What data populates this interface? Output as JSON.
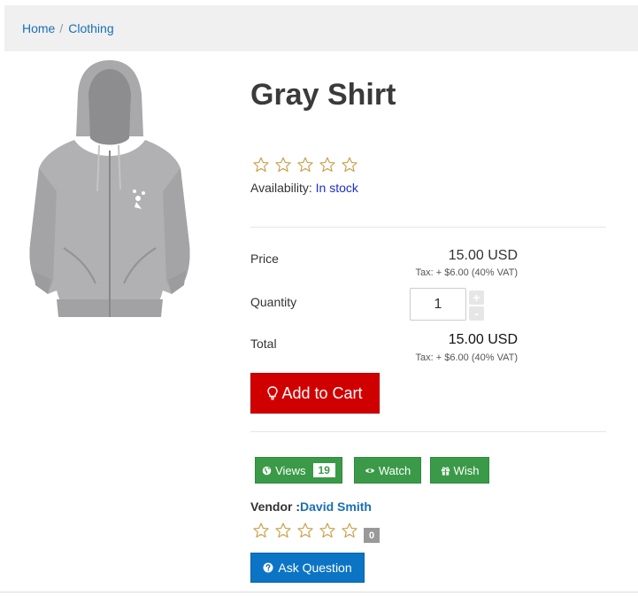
{
  "breadcrumb": {
    "home": "Home",
    "separator": "/",
    "category": "Clothing"
  },
  "product": {
    "title": "Gray Shirt",
    "availability_label": "Availability:",
    "availability_value": "In stock",
    "rating": 0,
    "max_rating": 5
  },
  "pricing": {
    "price_label": "Price",
    "price_value": "15.00 USD",
    "price_tax": "Tax: + $6.00 (40% VAT)",
    "quantity_label": "Quantity",
    "quantity_value": "1",
    "plus": "+",
    "minus": "-",
    "total_label": "Total",
    "total_value": "15.00 USD",
    "total_tax": "Tax: + $6.00 (40% VAT)"
  },
  "actions": {
    "add_to_cart": "Add to Cart",
    "views_label": "Views",
    "views_count": "19",
    "watch_label": "Watch",
    "wish_label": "Wish",
    "ask_question": "Ask Question"
  },
  "vendor": {
    "label": "Vendor :",
    "name": "David Smith",
    "rating_count": "0"
  },
  "colors": {
    "link": "#1a6fb5",
    "add_to_cart": "#d10000",
    "green_button": "#3a9a48",
    "ask_button": "#0b74c4",
    "star": "#c9a04a"
  },
  "icons": {
    "add_to_cart": "lightbulb-icon",
    "views": "globe-icon",
    "watch": "eye-icon",
    "wish": "gift-icon",
    "ask": "question-circle-icon",
    "rating": "star-outline-icon"
  }
}
